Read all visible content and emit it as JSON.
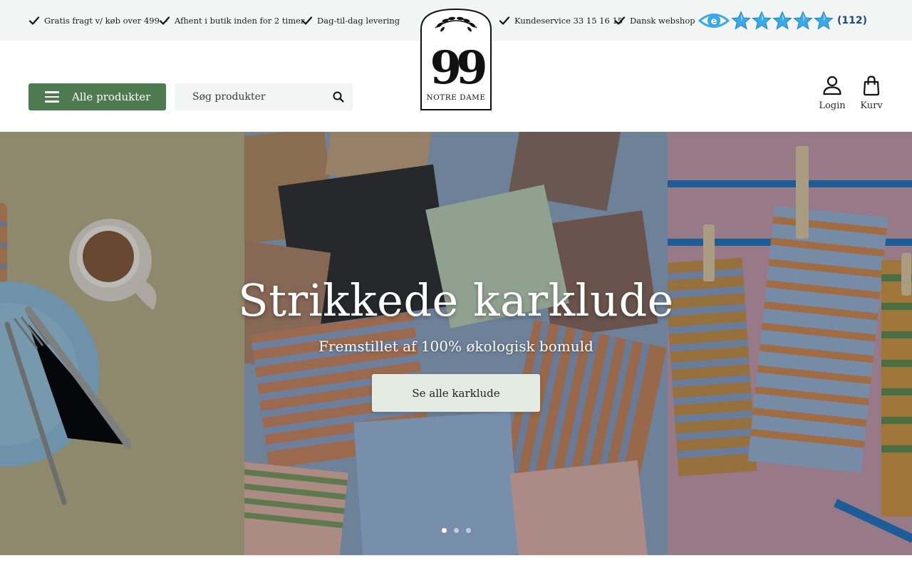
{
  "topbar": {
    "usps_left": [
      "Gratis fragt v/ køb over 499 .-",
      "Afhent i butik inden for 2 timer",
      "Dag-til-dag levering"
    ],
    "usps_right": [
      "Kundeservice 33 15 16 15",
      "Dansk webshop"
    ],
    "rating": {
      "stars": 5,
      "count_label": "(112)",
      "icon": "e-maerket-icon",
      "star_color": "#3aa9e8"
    }
  },
  "header": {
    "menu_button_label": "Alle produkter",
    "search_placeholder": "Søg produkter",
    "logo_text": "NOTRE DAME",
    "logo_number": "99",
    "login_label": "Login",
    "cart_label": "Kurv",
    "brand_color": "#4d7a4f"
  },
  "hero": {
    "title": "Strikkede karklude",
    "subtitle": "Fremstillet af 100% økologisk bomuld",
    "cta_label": "Se alle karklude",
    "slides": 3,
    "active_slide": 1
  }
}
